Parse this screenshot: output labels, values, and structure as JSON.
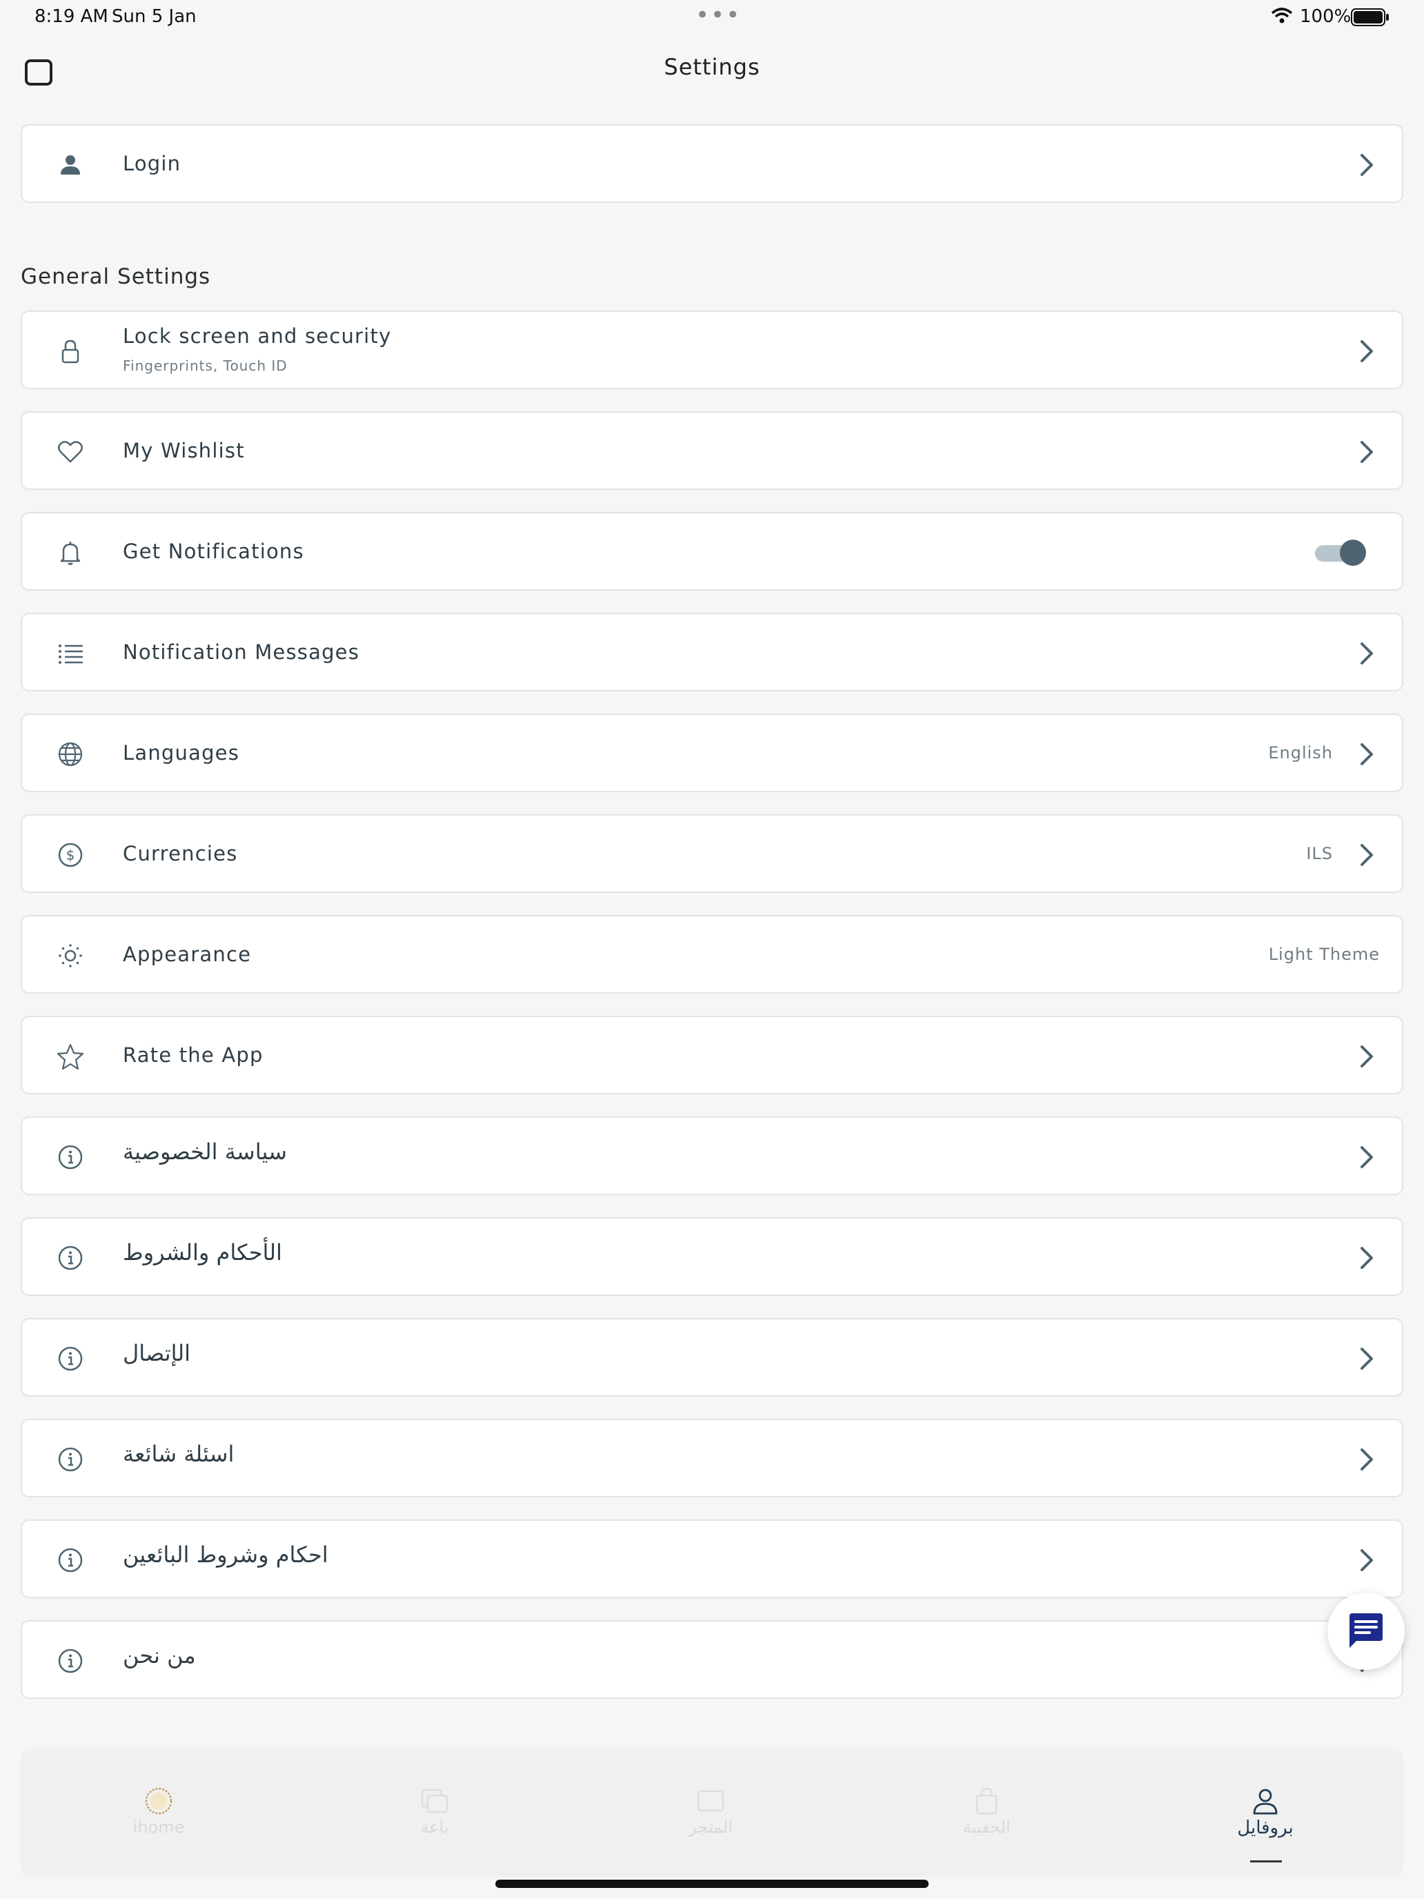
{
  "status_bar": {
    "time": "8:19 AM",
    "date": "Sun 5 Jan",
    "battery": "100%"
  },
  "header": {
    "title": "Settings"
  },
  "login": {
    "label": "Login"
  },
  "general_settings": {
    "title": "General Settings",
    "items": [
      {
        "label": "Lock screen and security",
        "sublabel": "Fingerprints, Touch ID",
        "icon": "lock-icon"
      },
      {
        "label": "My Wishlist",
        "icon": "heart-icon"
      },
      {
        "label": "Get Notifications",
        "icon": "bell-icon",
        "toggle_on": true
      },
      {
        "label": "Notification Messages",
        "icon": "list-icon"
      },
      {
        "label": "Languages",
        "value": "English",
        "icon": "globe-icon"
      },
      {
        "label": "Currencies",
        "value": "ILS",
        "icon": "dollar-circle-icon"
      },
      {
        "label": "Appearance",
        "value": "Light Theme",
        "icon": "sun-icon"
      },
      {
        "label": "Rate the App",
        "icon": "star-icon"
      },
      {
        "label": "سياسة الخصوصية",
        "icon": "info-icon"
      },
      {
        "label": "الأحكام والشروط",
        "icon": "info-icon"
      },
      {
        "label": "الإتصال",
        "icon": "info-icon"
      },
      {
        "label": "اسئلة شائعة",
        "icon": "info-icon"
      },
      {
        "label": "احكام وشروط البائعين",
        "icon": "info-icon"
      },
      {
        "label": "من نحن",
        "icon": "info-icon"
      }
    ]
  },
  "tab_bar": {
    "tabs": [
      {
        "label": "ihome",
        "icon": "home-logo-icon"
      },
      {
        "label": "باعة",
        "icon": "sellers-icon"
      },
      {
        "label": "المتجر",
        "icon": "store-icon"
      },
      {
        "label": "الحقيبة",
        "icon": "bag-icon"
      },
      {
        "label": "بروفايل",
        "icon": "profile-icon",
        "active": true
      }
    ]
  },
  "colors": {
    "icon": "#4e6470",
    "accent_chat": "#1b2a8c",
    "active_tab": "#223b52"
  }
}
